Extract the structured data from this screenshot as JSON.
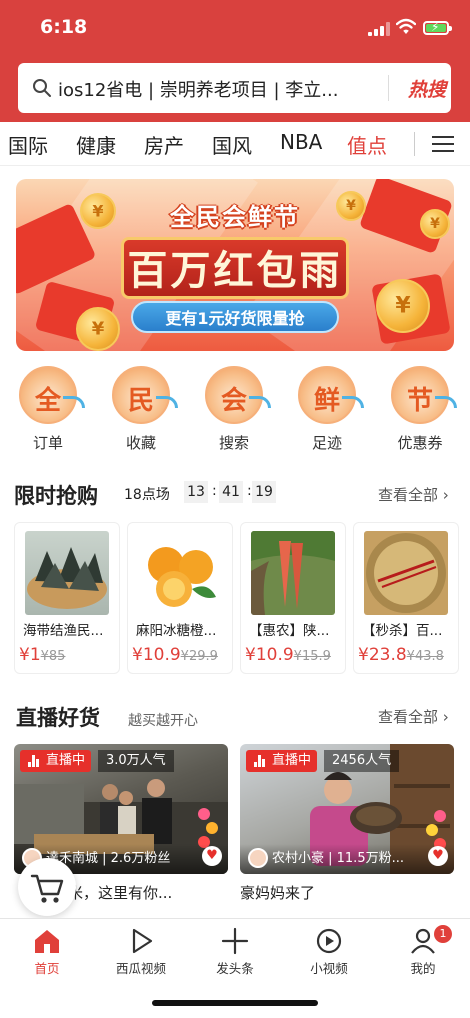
{
  "status": {
    "time": "6:18"
  },
  "search": {
    "text": "ios12省电 | 崇明养老项目 | 李立...",
    "hot_label": "热搜"
  },
  "channels": [
    "国际",
    "健康",
    "房产",
    "国风",
    "NBA",
    "值点"
  ],
  "banner": {
    "title": "全民会鲜节",
    "main": "百万红包雨",
    "pill": "更有1元好货限量抢"
  },
  "quick_icons": [
    {
      "glyph": "全",
      "label": "订单"
    },
    {
      "glyph": "民",
      "label": "收藏"
    },
    {
      "glyph": "会",
      "label": "搜索"
    },
    {
      "glyph": "鲜",
      "label": "足迹"
    },
    {
      "glyph": "节",
      "label": "优惠券"
    }
  ],
  "flash_sale": {
    "title": "限时抢购",
    "session": "18点场",
    "timer": [
      "13",
      "41",
      "19"
    ],
    "see_all": "查看全部",
    "products": [
      {
        "name": "海带结渔民...",
        "price": "¥1",
        "old_price": "¥85"
      },
      {
        "name": "麻阳冰糖橙...",
        "price": "¥10.9",
        "old_price": "¥29.9"
      },
      {
        "name": "【惠农】陕...",
        "price": "¥10.9",
        "old_price": "¥15.9"
      },
      {
        "name": "【秒杀】百...",
        "price": "¥23.8",
        "old_price": "¥43.8"
      }
    ]
  },
  "live": {
    "title": "直播好货",
    "subtitle": "越买越开心",
    "see_all": "查看全部",
    "items": [
      {
        "badge": "直播中",
        "popularity": "3.0万人气",
        "author": "達禾南城 | 2.6万粉丝",
        "desc": "分大米，这里有你..."
      },
      {
        "badge": "直播中",
        "popularity": "2456人气",
        "author": "农村小豪 | 11.5万粉...",
        "desc": "豪妈妈来了"
      }
    ]
  },
  "bottom_nav": [
    {
      "label": "首页",
      "icon": "home-icon"
    },
    {
      "label": "西瓜视频",
      "icon": "play-icon"
    },
    {
      "label": "发头条",
      "icon": "plus-icon"
    },
    {
      "label": "小视频",
      "icon": "small-video-icon"
    },
    {
      "label": "我的",
      "icon": "profile-icon"
    }
  ],
  "profile_badge": "1",
  "colors": {
    "brand_red": "#d9413e",
    "accent": "#e0403a"
  }
}
